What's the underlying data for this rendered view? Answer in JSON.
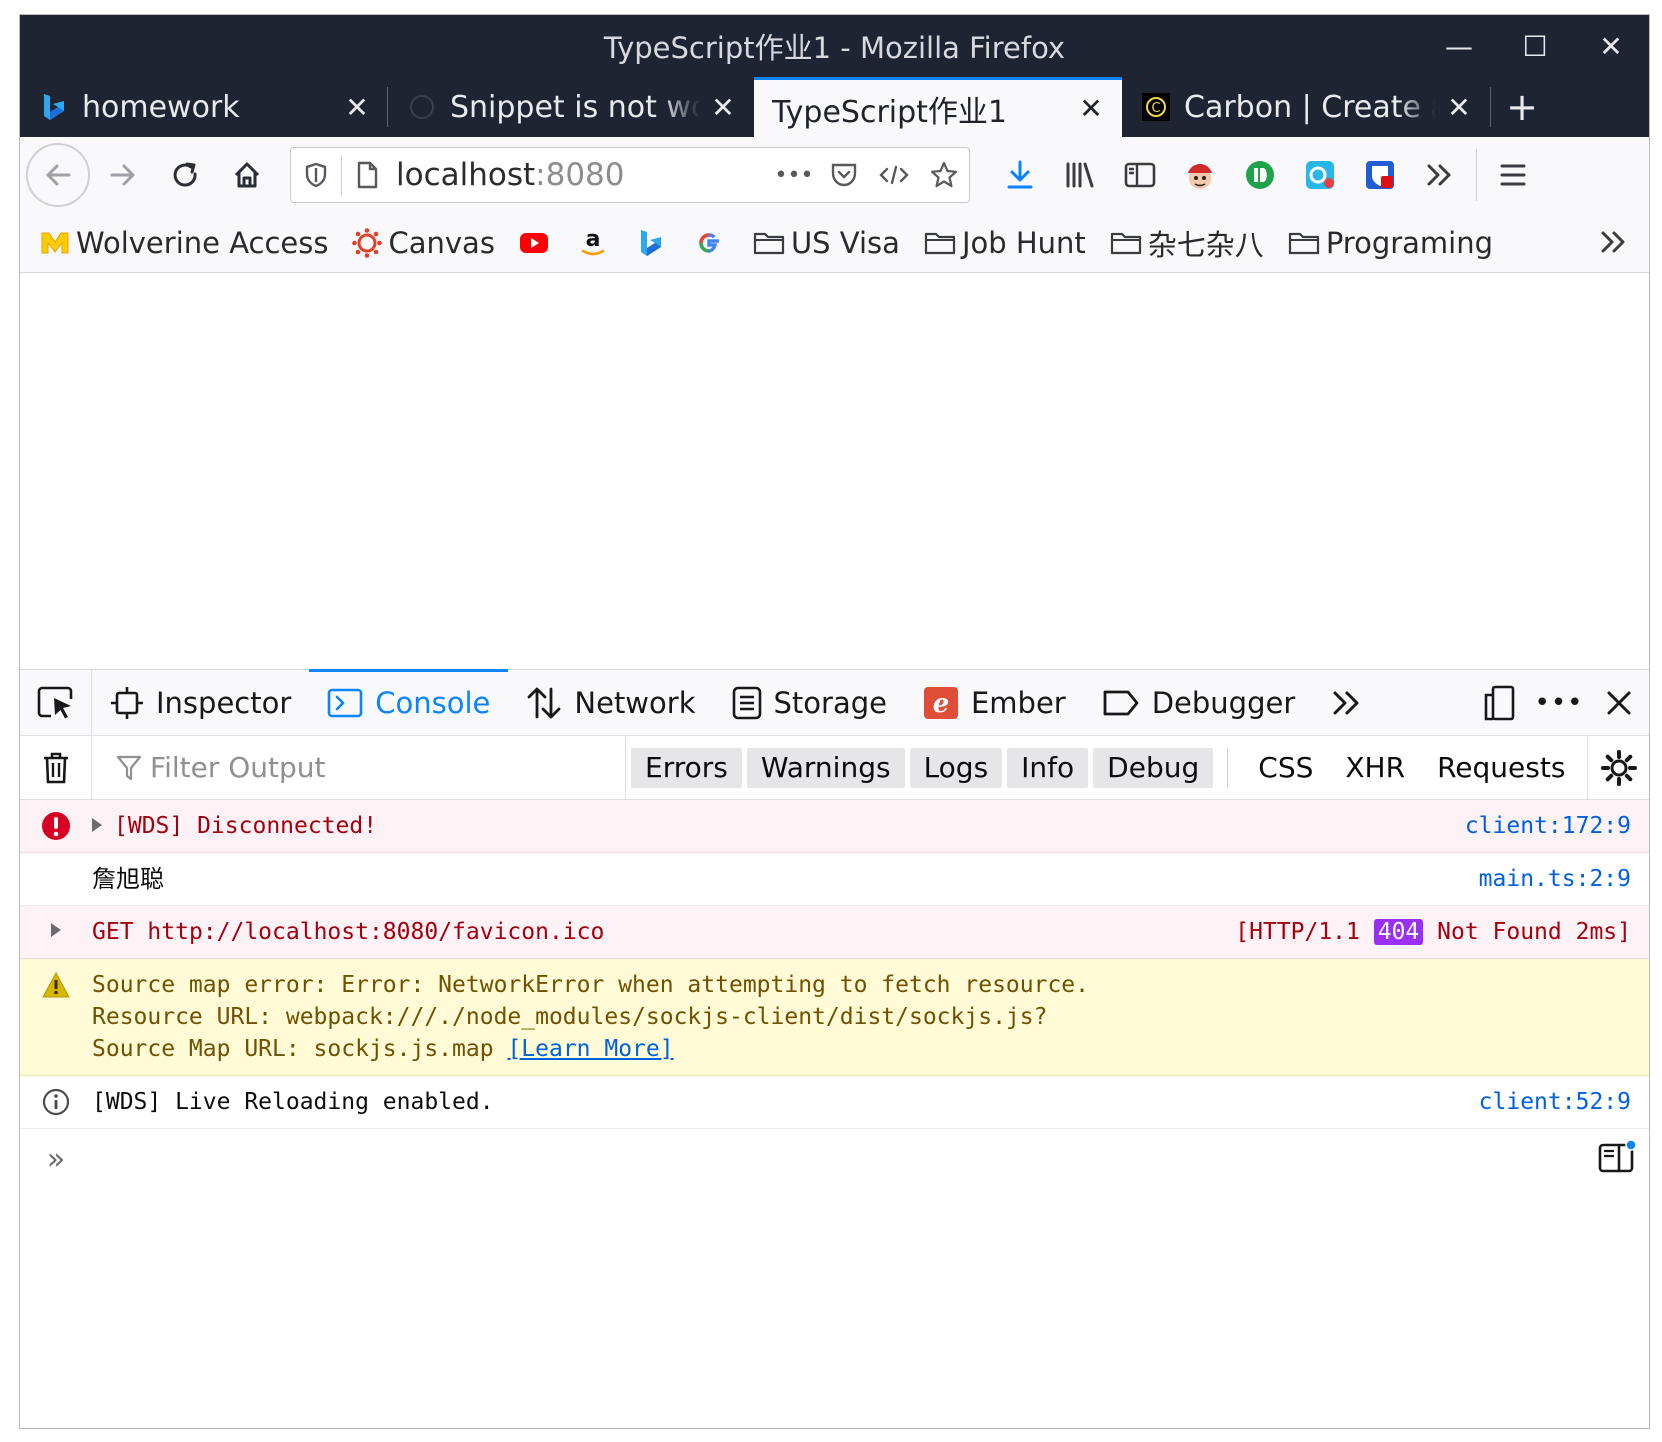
{
  "window": {
    "title": "TypeScript作业1 - Mozilla Firefox",
    "controls": {
      "minimize": "—",
      "maximize": "☐",
      "close": "✕"
    }
  },
  "tabs": [
    {
      "label": "homework",
      "icon": "bing-icon",
      "active": false
    },
    {
      "label": "Snippet is not working",
      "icon": "github-icon",
      "active": false
    },
    {
      "label": "TypeScript作业1",
      "icon": "",
      "active": true
    },
    {
      "label": "Carbon | Create and share",
      "icon": "carbon-icon",
      "active": false
    }
  ],
  "tab_close": "✕",
  "new_tab": "+",
  "navbar": {
    "url_host": "localhost",
    "url_port": ":8080",
    "page_actions": "•••"
  },
  "bookmarks": [
    {
      "label": "Wolverine Access",
      "icon": "michigan-icon"
    },
    {
      "label": "Canvas",
      "icon": "canvas-icon"
    },
    {
      "label": "",
      "icon": "youtube-icon"
    },
    {
      "label": "",
      "icon": "amazon-icon"
    },
    {
      "label": "",
      "icon": "bing-icon"
    },
    {
      "label": "",
      "icon": "google-icon"
    },
    {
      "label": "US Visa",
      "icon": "folder-icon"
    },
    {
      "label": "Job Hunt",
      "icon": "folder-icon"
    },
    {
      "label": "杂七杂八",
      "icon": "folder-icon"
    },
    {
      "label": "Programing",
      "icon": "folder-icon"
    }
  ],
  "devtools": {
    "tabs": [
      {
        "label": "Inspector",
        "icon": "inspector-icon",
        "active": false
      },
      {
        "label": "Console",
        "icon": "console-icon",
        "active": true
      },
      {
        "label": "Network",
        "icon": "network-icon",
        "active": false
      },
      {
        "label": "Storage",
        "icon": "storage-icon",
        "active": false
      },
      {
        "label": "Ember",
        "icon": "ember-icon",
        "active": false
      },
      {
        "label": "Debugger",
        "icon": "debugger-icon",
        "active": false
      }
    ],
    "filter_placeholder": "Filter Output",
    "filter_buttons": [
      "Errors",
      "Warnings",
      "Logs",
      "Info",
      "Debug"
    ],
    "filter_plain": [
      "CSS",
      "XHR",
      "Requests"
    ],
    "messages": {
      "m1": {
        "text": "[WDS] Disconnected!",
        "source": "client:172:9"
      },
      "m2": {
        "text": "詹旭聪",
        "source": "main.ts:2:9"
      },
      "m3": {
        "method": "GET",
        "url": "http://localhost:8080/favicon.ico",
        "status_prefix": "[HTTP/1.1",
        "status_code": "404",
        "status_suffix": "Not Found 2ms]"
      },
      "m4": {
        "line1": "Source map error: Error: NetworkError when attempting to fetch resource.",
        "line2": "Resource URL: webpack:///./node_modules/sockjs-client/dist/sockjs.js?",
        "line3": "Source Map URL: sockjs.js.map",
        "learn_more": "[Learn More]"
      },
      "m5": {
        "text": "[WDS] Live Reloading enabled.",
        "source": "client:52:9"
      }
    },
    "prompt_symbol": "»"
  }
}
